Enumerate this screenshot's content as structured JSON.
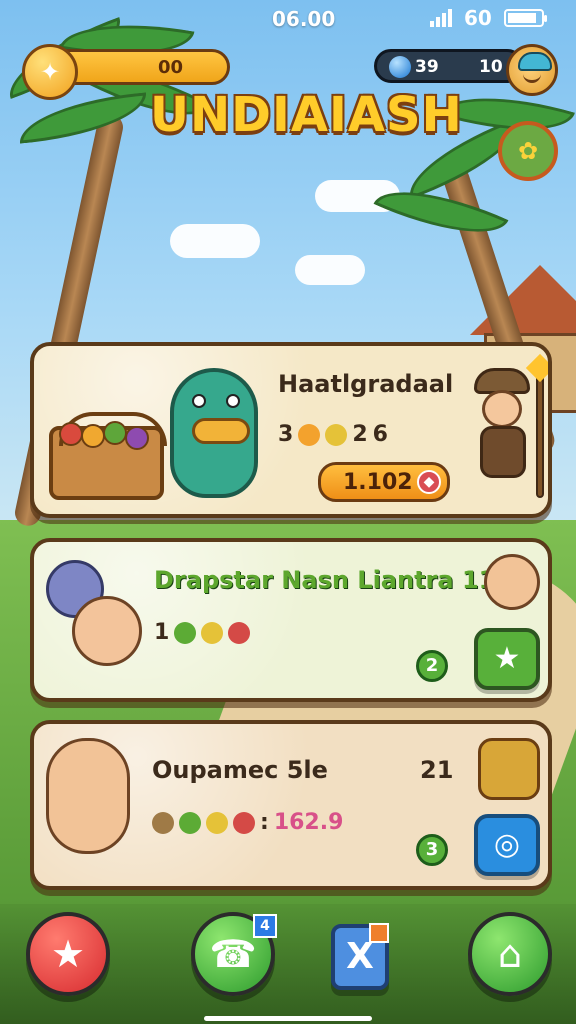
{
  "status_bar": {
    "time": "06.00",
    "right_text": "60"
  },
  "hud": {
    "coins": "00",
    "energy_left": "39",
    "energy_right": "10"
  },
  "header": {
    "title": "UNDIAIASH"
  },
  "cards": [
    {
      "title": "Haatlgradaal",
      "stats_prefix": "3",
      "stats_mid": "2",
      "stats_suffix": "6",
      "price": "1.102"
    },
    {
      "title": "Drapstar Nasn Liantra 11",
      "stats_prefix": "1",
      "stats_value": "2"
    },
    {
      "title": "Oupamec 5le",
      "count": "21",
      "stats_value": "162.9",
      "round_value": "3"
    }
  ],
  "bottom_nav": {
    "phone_badge": "4",
    "center_label": "X"
  },
  "colors": {
    "accent_orange": "#f0a51a",
    "accent_green": "#58b03a",
    "accent_blue": "#2a8edf",
    "accent_red": "#d72b2f"
  }
}
